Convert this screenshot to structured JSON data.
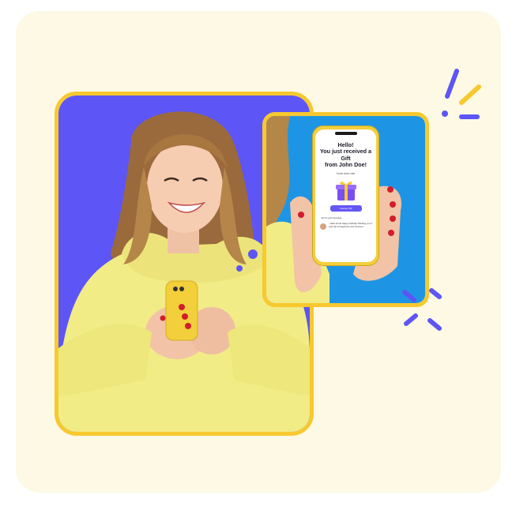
{
  "colors": {
    "card_background": "#FEF9E4",
    "frame_border": "#F7C92F",
    "main_photo_background": "#5D55F5",
    "side_photo_background": "#1E95E4",
    "accent_purple": "#6557F5",
    "accent_yellow": "#F7C92F",
    "hoodie_yellow": "#F1EC86"
  },
  "phone_screen": {
    "title_line1": "Hello!",
    "title_line2": "You just received a Gift",
    "title_line3": "from John Doe!",
    "subtitle": "Some short note",
    "button_label": "Unwrap Gift",
    "message_label": "John's gift message",
    "message_text": "\" Hello Anna! Happy birthday! Wishing you a year full of happiness and success! \""
  },
  "icons": {
    "gift": "gift-box-icon",
    "sparkles": "sparkle-lines-icon"
  }
}
